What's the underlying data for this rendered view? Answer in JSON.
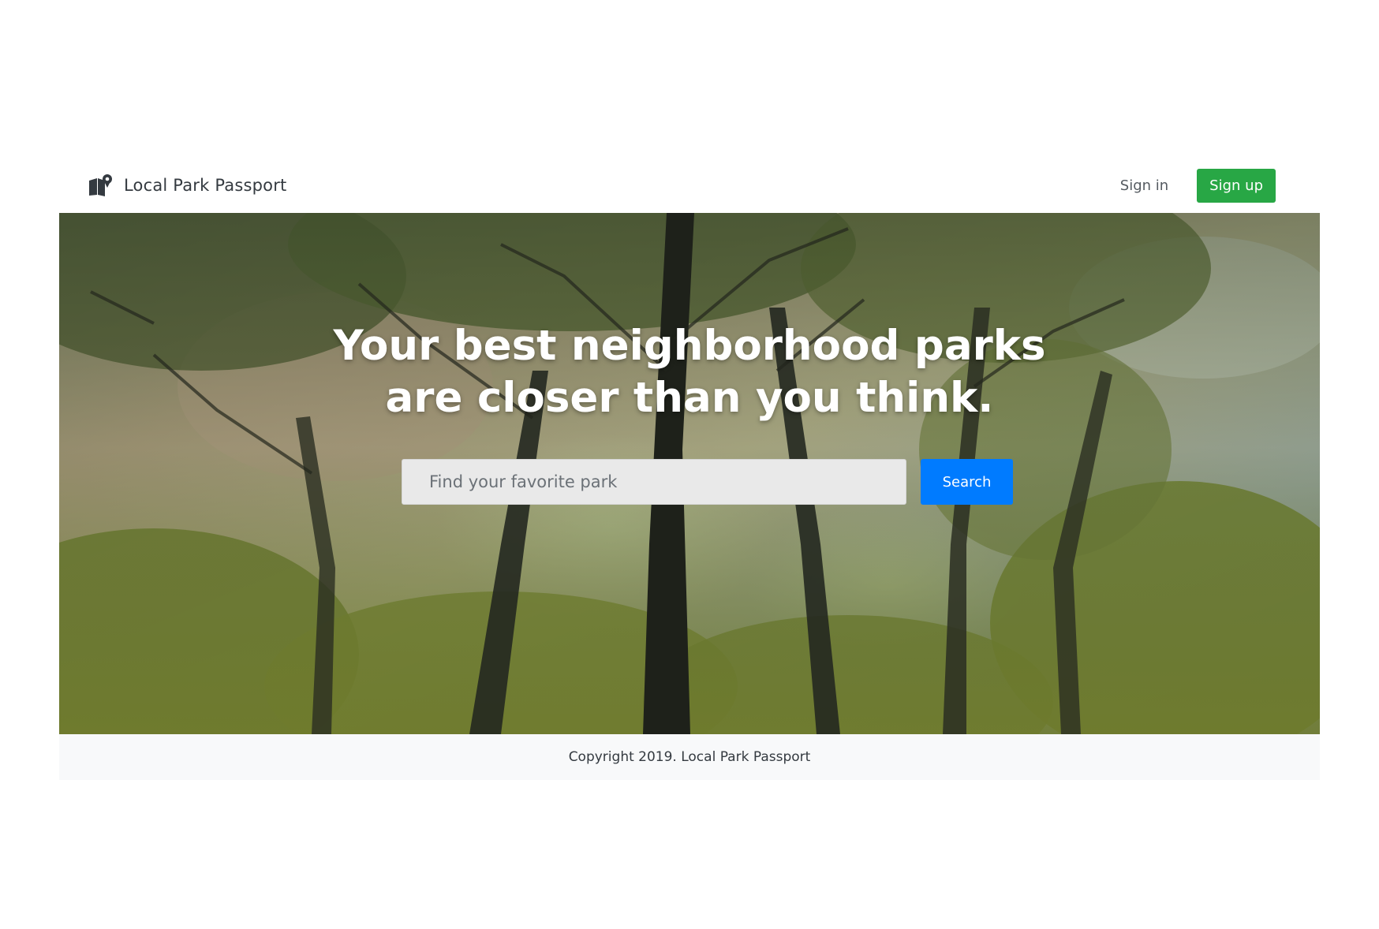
{
  "navbar": {
    "brand": "Local Park Passport",
    "brand_icon": "park-passport-logo-icon",
    "sign_in": "Sign in",
    "sign_up": "Sign up",
    "sign_up_color": "#28a745"
  },
  "hero": {
    "headline_line1": "Your best neighborhood parks",
    "headline_line2": "are closer than you think.",
    "search_placeholder": "Find your favorite park",
    "search_button": "Search",
    "search_button_color": "#007bff",
    "background": "forest-canopy-photo"
  },
  "footer": {
    "copyright": "Copyright 2019. Local Park Passport"
  }
}
